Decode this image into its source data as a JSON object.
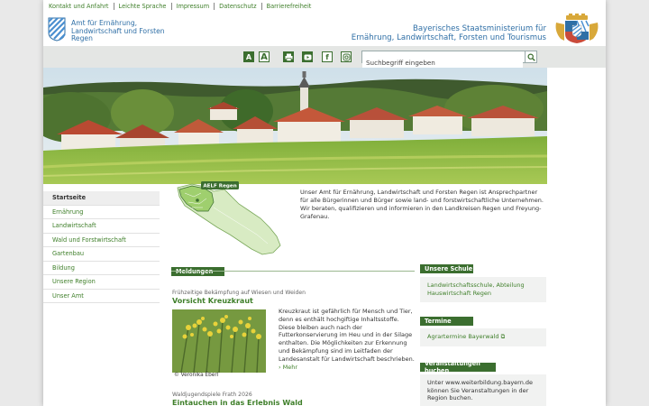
{
  "topnav": [
    "Kontakt und Anfahrt",
    "Leichte Sprache",
    "Impressum",
    "Datenschutz",
    "Barrierefreiheit"
  ],
  "amt": {
    "line1": "Amt für Ernährung,",
    "line2": "Landwirtschaft und Forsten",
    "line3": "Regen"
  },
  "ministry": {
    "line1": "Bayerisches Staatsministerium für",
    "line2": "Ernährung, Landwirtschaft, Forsten und Tourismus"
  },
  "toolbar": {
    "font_small": "A",
    "font_large": "A",
    "facebook": "f",
    "search_placeholder": "Suchbegriff eingeben"
  },
  "sidebar": {
    "items": [
      {
        "label": "Startseite",
        "active": true
      },
      {
        "label": "Ernährung",
        "active": false
      },
      {
        "label": "Landwirtschaft",
        "active": false
      },
      {
        "label": "Wald und Forstwirtschaft",
        "active": false
      },
      {
        "label": "Gartenbau",
        "active": false
      },
      {
        "label": "Bildung",
        "active": false
      },
      {
        "label": "Unsere Region",
        "active": false
      },
      {
        "label": "Unser Amt",
        "active": false
      }
    ]
  },
  "map": {
    "badge": "AELF Regen"
  },
  "intro": "Unser Amt für Ernährung, Landwirtschaft und Forsten Regen ist Ansprechpartner für alle Bürgerinnen und Bürger sowie land- und forstwirtschaftliche Unternehmen. Wir beraten, qualifizieren und informieren in den Landkreisen Regen und Freyung-Grafenau.",
  "meldungen": {
    "heading": "Meldungen",
    "article1": {
      "kicker": "Frühzeitige Bekämpfung auf Wiesen und Weiden",
      "title": "Vorsicht Kreuzkraut",
      "text": "Kreuzkraut ist gefährlich für Mensch und Tier, denn es enthält hochgiftige Inhaltsstoffe. Diese bleiben auch nach der Futterkonservierung im Heu und in der Silage enthalten. Die Möglichkeiten zur Erkennung und Bekämpfung sind im Leitfaden der Landesanstalt für Landwirtschaft beschrieben.",
      "more": "Mehr",
      "credit": "© Veronika Eberl"
    },
    "article2": {
      "kicker": "Waldjugendspiele Frath 2026",
      "title": "Eintauchen in das Erlebnis Wald"
    }
  },
  "right": {
    "schule": {
      "heading": "Unsere Schule",
      "link": "Landwirtschaftsschule, Abteilung Hauswirtschaft Regen"
    },
    "termine": {
      "heading": "Termine",
      "link": "Agrartermine Bayerwald"
    },
    "veranstaltungen": {
      "heading": "Veranstaltungen buchen",
      "text": "Unter www.weiterbildung.bayern.de können Sie Veranstaltungen in der Region buchen."
    }
  },
  "colors": {
    "brand_green": "#3b6e2f",
    "link_green": "#3f7f2a",
    "ministry_blue": "#2f6fa6"
  }
}
